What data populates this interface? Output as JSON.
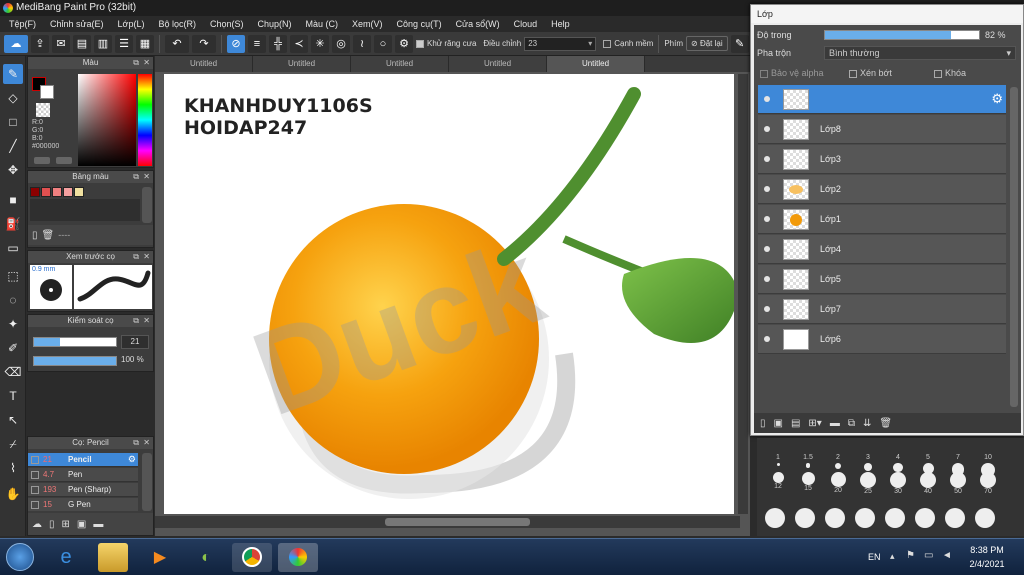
{
  "app": {
    "title": "MediBang Paint Pro (32bit)"
  },
  "menu": [
    "Tệp(F)",
    "Chỉnh sửa(E)",
    "Lớp(L)",
    "Bộ lọc(R)",
    "Chọn(S)",
    "Chụp(N)",
    "Màu (C)",
    "Xem(V)",
    "Công cụ(T)",
    "Cửa sổ(W)",
    "Cloud",
    "Help"
  ],
  "toolbar": {
    "antialias_label": "Khử răng cưa",
    "adjust_label": "Điều chỉnh",
    "adjust_value": "23",
    "edge_label": "Cạnh mềm",
    "pen_label": "Phím",
    "reset_label": "Đặt lại"
  },
  "panels": {
    "color": {
      "title": "Màu",
      "r": "R:0",
      "g": "G:0",
      "b": "B:0",
      "hex": "#000000"
    },
    "palette": {
      "title": "Bảng màu",
      "dash": "----",
      "swatches": [
        "#8b0000",
        "#e05050",
        "#f08080",
        "#f4a0a0",
        "#f0e0a0"
      ]
    },
    "preview": {
      "title": "Xem trước cọ",
      "size": "0.9 mm"
    },
    "brushctl": {
      "title": "Kiểm soát cọ",
      "size_value": "21",
      "opacity_value": "100 %",
      "size_fill": 0.32,
      "opacity_fill": 1.0
    },
    "brushlist": {
      "title": "Cọ: Pencil",
      "items": [
        {
          "size": "21",
          "name": "Pencil",
          "selected": true
        },
        {
          "size": "4.7",
          "name": "Pen",
          "selected": false
        },
        {
          "size": "193",
          "name": "Pen (Sharp)",
          "selected": false
        },
        {
          "size": "15",
          "name": "G Pen",
          "selected": false
        }
      ]
    }
  },
  "tabs": [
    "Untitled",
    "Untitled",
    "Untitled",
    "Untitled",
    "Untitled"
  ],
  "canvas": {
    "line1": "KHANHDUY1106S",
    "line2": "HOIDAP247",
    "watermark": "Duck"
  },
  "layers": {
    "title": "Lớp",
    "opacity_label": "Độ trong",
    "opacity_value": "82 %",
    "opacity_fill": 0.82,
    "blend_label": "Pha trộn",
    "blend_value": "Bình thường",
    "protect_alpha": "Bảo vệ alpha",
    "clipping": "Xén bớt",
    "lock": "Khóa",
    "items": [
      {
        "name": "",
        "selected": true
      },
      {
        "name": "Lớp8"
      },
      {
        "name": "Lớp3"
      },
      {
        "name": "Lớp2"
      },
      {
        "name": "Lớp1"
      },
      {
        "name": "Lớp4"
      },
      {
        "name": "Lớp5"
      },
      {
        "name": "Lớp7"
      },
      {
        "name": "Lớp6"
      }
    ]
  },
  "brush_sizes": {
    "row1": [
      "1",
      "1.5",
      "2",
      "3",
      "4",
      "5",
      "7",
      "10"
    ],
    "row2": [
      "12",
      "15",
      "20",
      "25",
      "30",
      "40",
      "50",
      "70"
    ]
  },
  "tray": {
    "lang": "EN",
    "time": "8:38 PM",
    "date": "2/4/2021"
  },
  "colors": {
    "accent": "#3e88d8",
    "orange": "#f5a20f",
    "leaf": "#4f8f2f"
  }
}
